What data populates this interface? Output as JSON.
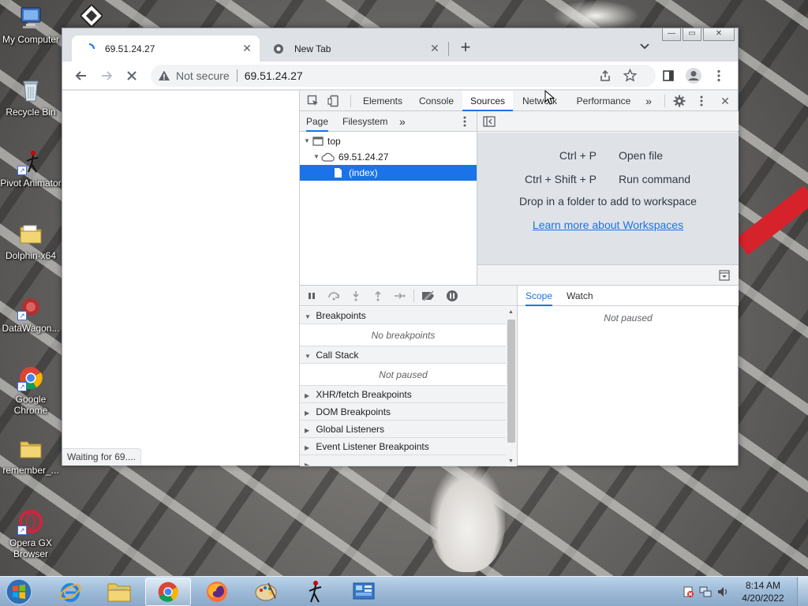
{
  "desktop": {
    "icons": [
      {
        "label": "My Computer",
        "icon": "computer-icon"
      },
      {
        "label": "Recycle Bin",
        "icon": "recycle-bin-icon"
      },
      {
        "label": "Pivot Animator",
        "icon": "pivot-animator-icon"
      },
      {
        "label": "Dolphin-x64",
        "icon": "folder-icon"
      },
      {
        "label": "DataWagon...",
        "icon": "datawagon-icon"
      },
      {
        "label": "Google Chrome",
        "icon": "chrome-icon"
      },
      {
        "label": "remember_...",
        "icon": "folder-icon"
      },
      {
        "label": "Opera GX Browser",
        "icon": "opera-icon"
      }
    ]
  },
  "browser": {
    "tabs": [
      {
        "title": "69.51.24.27",
        "close": "✕",
        "loading": true
      },
      {
        "title": "New Tab",
        "close": "✕"
      }
    ],
    "new_tab": "+",
    "tab_search": "⌄",
    "window_controls": {
      "minimize": "—",
      "maximize": "▭",
      "close": "✕"
    },
    "toolbar": {
      "security_label": "Not secure",
      "url": "69.51.24.27"
    },
    "status_bubble": "Waiting for 69...."
  },
  "devtools": {
    "tabs": [
      "Elements",
      "Console",
      "Sources",
      "Network",
      "Performance"
    ],
    "active_tab": "Sources",
    "more_tabs": "»",
    "close": "✕",
    "navigator": {
      "tabs": [
        "Page",
        "Filesystem"
      ],
      "more": "»",
      "tree": [
        {
          "label": "top",
          "level": 0
        },
        {
          "label": "69.51.24.27",
          "level": 1
        },
        {
          "label": "(index)",
          "level": 2,
          "selected": true
        }
      ]
    },
    "editor": {
      "shortcuts": [
        {
          "keys": "Ctrl + P",
          "action": "Open file"
        },
        {
          "keys": "Ctrl + Shift + P",
          "action": "Run command"
        }
      ],
      "workspace_message": "Drop in a folder to add to workspace",
      "workspace_link": "Learn more about Workspaces"
    },
    "debugger": {
      "sections": [
        {
          "title": "Breakpoints",
          "expanded": true,
          "empty": "No breakpoints"
        },
        {
          "title": "Call Stack",
          "expanded": true,
          "empty": "Not paused"
        },
        {
          "title": "XHR/fetch Breakpoints",
          "expanded": false
        },
        {
          "title": "DOM Breakpoints",
          "expanded": false
        },
        {
          "title": "Global Listeners",
          "expanded": false
        },
        {
          "title": "Event Listener Breakpoints",
          "expanded": false
        }
      ]
    },
    "scope": {
      "tabs": [
        "Scope",
        "Watch"
      ],
      "active": "Scope",
      "empty": "Not paused"
    }
  },
  "taskbar": {
    "apps": [
      "internet-explorer",
      "file-explorer",
      "chrome",
      "firefox",
      "paint",
      "pivot-animator",
      "control-panel"
    ],
    "active_app": "chrome",
    "clock": {
      "time": "8:14 AM",
      "date": "4/20/2022"
    }
  },
  "colors": {
    "accent": "#1a73e8",
    "selection": "#1a73e8"
  }
}
